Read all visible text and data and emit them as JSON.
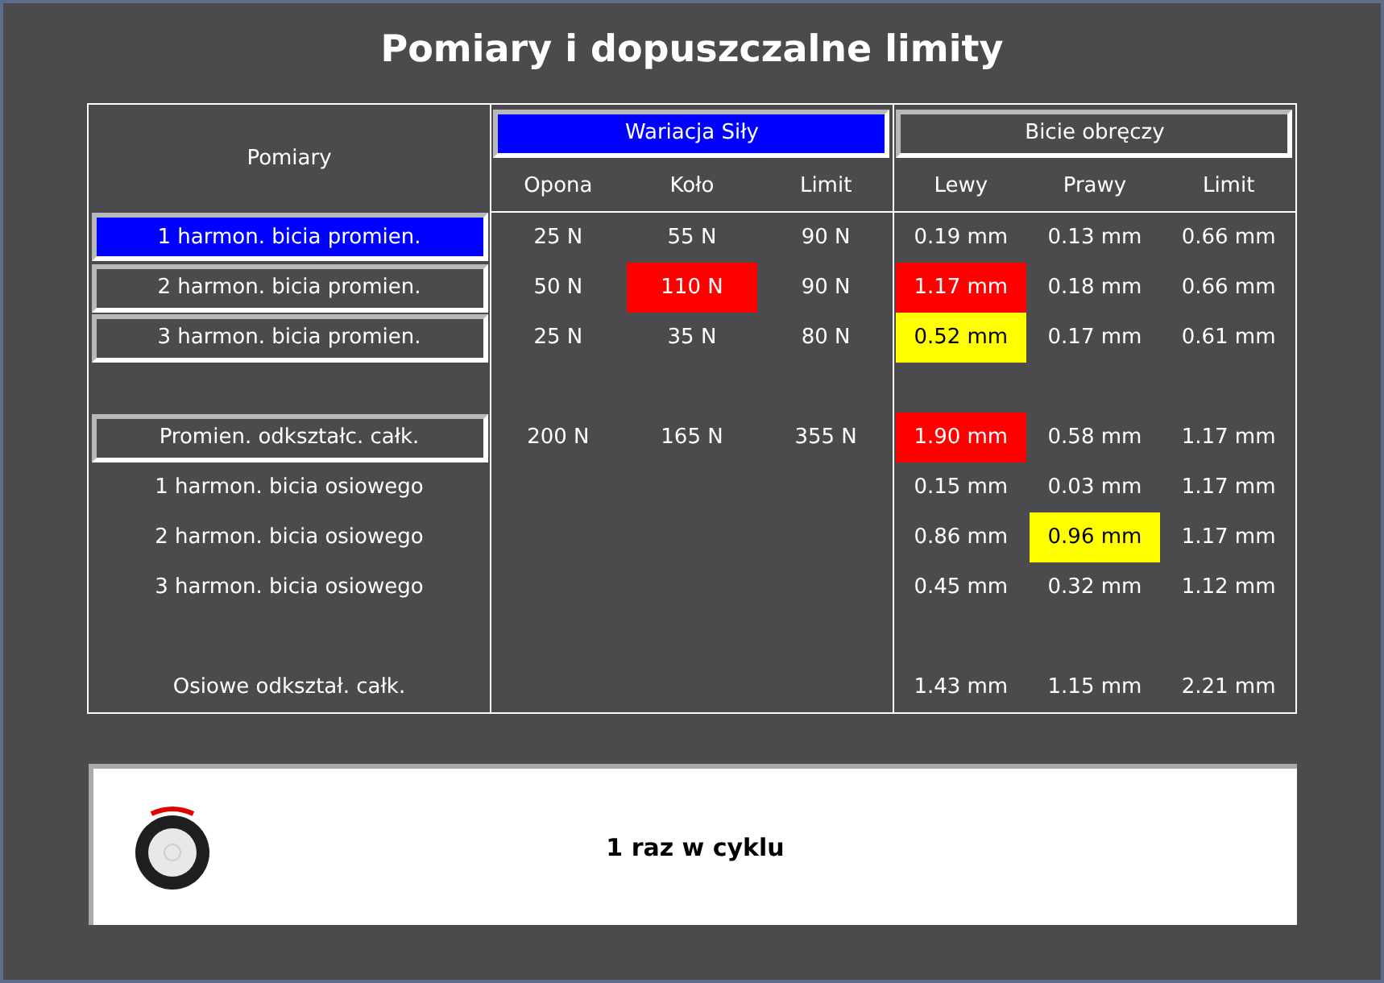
{
  "title": "Pomiary i dopuszczalne limity",
  "table": {
    "corner": "Pomiary",
    "groups": [
      {
        "label": "Wariacja Siły",
        "selected": true
      },
      {
        "label": "Bicie obręczy",
        "selected": false
      }
    ],
    "columns": [
      "Opona",
      "Koło",
      "Limit",
      "Lewy",
      "Prawy",
      "Limit"
    ],
    "rows": [
      {
        "kind": "button",
        "label": "1 harmon. bicia promien.",
        "selected": true,
        "cells": [
          {
            "text": "25 N"
          },
          {
            "text": "55 N"
          },
          {
            "text": "90 N"
          },
          {
            "text": "0.19 mm"
          },
          {
            "text": "0.13 mm"
          },
          {
            "text": "0.66 mm"
          }
        ]
      },
      {
        "kind": "button",
        "label": "2 harmon. bicia promien.",
        "selected": false,
        "cells": [
          {
            "text": "50 N"
          },
          {
            "text": "110 N",
            "color": "#ff0000"
          },
          {
            "text": "90 N"
          },
          {
            "text": "1.17 mm",
            "color": "#ff0000"
          },
          {
            "text": "0.18 mm"
          },
          {
            "text": "0.66 mm"
          }
        ]
      },
      {
        "kind": "button",
        "label": "3 harmon. bicia promien.",
        "selected": false,
        "cells": [
          {
            "text": "25 N"
          },
          {
            "text": "35 N"
          },
          {
            "text": "80 N"
          },
          {
            "text": "0.52 mm",
            "color": "#ffff00"
          },
          {
            "text": "0.17 mm"
          },
          {
            "text": "0.61 mm"
          }
        ]
      },
      {
        "kind": "spacer"
      },
      {
        "kind": "button",
        "label": "Promien. odkształc. całk.",
        "selected": false,
        "cells": [
          {
            "text": "200 N"
          },
          {
            "text": "165 N"
          },
          {
            "text": "355 N"
          },
          {
            "text": "1.90 mm",
            "color": "#ff0000"
          },
          {
            "text": "0.58 mm"
          },
          {
            "text": "1.17 mm"
          }
        ]
      },
      {
        "kind": "label",
        "label": "1 harmon. bicia osiowego",
        "cells": [
          null,
          null,
          null,
          {
            "text": "0.15 mm"
          },
          {
            "text": "0.03 mm"
          },
          {
            "text": "1.17 mm"
          }
        ]
      },
      {
        "kind": "label",
        "label": "2 harmon. bicia osiowego",
        "cells": [
          null,
          null,
          null,
          {
            "text": "0.86 mm"
          },
          {
            "text": "0.96 mm",
            "color": "#ffff00"
          },
          {
            "text": "1.17 mm"
          }
        ]
      },
      {
        "kind": "label",
        "label": "3 harmon. bicia osiowego",
        "cells": [
          null,
          null,
          null,
          {
            "text": "0.45 mm"
          },
          {
            "text": "0.32 mm"
          },
          {
            "text": "1.12 mm"
          }
        ]
      },
      {
        "kind": "spacer"
      },
      {
        "kind": "label",
        "label": "Osiowe odkształ. całk.",
        "cells": [
          null,
          null,
          null,
          {
            "text": "1.43 mm"
          },
          {
            "text": "1.15 mm"
          },
          {
            "text": "2.21 mm"
          }
        ]
      }
    ]
  },
  "footer": {
    "message": "1 raz w cyklu"
  }
}
